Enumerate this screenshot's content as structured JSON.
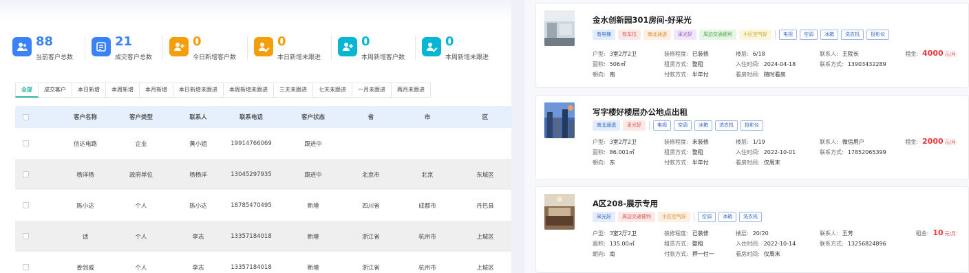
{
  "stats": [
    {
      "value": "88",
      "label": "当前客户总数",
      "color": "#3b82f6",
      "icon": "users-icon"
    },
    {
      "value": "21",
      "label": "成交客户总数",
      "color": "#3b82f6",
      "icon": "deal-icon"
    },
    {
      "value": "0",
      "label": "今日新增客户数",
      "color": "#f59e0b",
      "icon": "user-add-icon"
    },
    {
      "value": "0",
      "label": "本日新增未跟进",
      "color": "#f59e0b",
      "icon": "user-edit-icon"
    },
    {
      "value": "0",
      "label": "本周新增客户数",
      "color": "#06b6d4",
      "icon": "user-add-icon"
    },
    {
      "value": "0",
      "label": "本周新增未跟进",
      "color": "#06b6d4",
      "icon": "user-edit-icon"
    }
  ],
  "tabs": [
    "全部",
    "成交客户",
    "本日新增",
    "本周新增",
    "本月新增",
    "本日新增未跟进",
    "本周新增未跟进",
    "三天未跟进",
    "七天未跟进",
    "一月未跟进",
    "两月未跟进"
  ],
  "table": {
    "headers": [
      "客户名称",
      "客户类型",
      "联系人",
      "联系电话",
      "客户状态",
      "省",
      "市",
      "区"
    ],
    "rows": [
      [
        "信达电路",
        "企业",
        "黄小姐",
        "19914766069",
        "跟进中",
        "",
        "",
        ""
      ],
      [
        "杨洋杨",
        "政府单位",
        "杨杨洋",
        "13045297935",
        "跟进中",
        "北京市",
        "北京",
        "东城区"
      ],
      [
        "陈小达",
        "个人",
        "陈小达",
        "18785470495",
        "新增",
        "四川省",
        "成都市",
        "丹巴县"
      ],
      [
        "话",
        "个人",
        "李志",
        "13357184018",
        "新增",
        "浙江省",
        "杭州市",
        "上城区"
      ],
      [
        "姜剑威",
        "个人",
        "李志",
        "13357184018",
        "新增",
        "浙江省",
        "杭州市",
        "上城区"
      ]
    ]
  },
  "listings": [
    {
      "title": "金水创新园301房间-好采光",
      "tags": [
        {
          "text": "有电梯",
          "style": "blue"
        },
        {
          "text": "有车位",
          "style": "red"
        },
        {
          "text": "南北通透",
          "style": "orange"
        },
        {
          "text": "采光好",
          "style": "purple"
        },
        {
          "text": "周边交通便利",
          "style": "green"
        },
        {
          "text": "小区空气好",
          "style": "yellow"
        }
      ],
      "facilities": [
        "电视",
        "空调",
        "冰箱",
        "洗衣机",
        "投影仪"
      ],
      "huxing_label": "户型:",
      "huxing": "3室2厅2卫",
      "zhuangxiu_label": "装修程度:",
      "zhuangxiu": "已装修",
      "louceng_label": "楼层:",
      "louceng": "6/18",
      "lianxiren_label": "联系人:",
      "lianxiren": "王院长",
      "mianji_label": "面积:",
      "mianji": "506㎡",
      "zulin_label": "租赁方式:",
      "zulin": "整租",
      "ruzhu_label": "入住时间:",
      "ruzhu": "2024-04-18",
      "lianxi_label": "联系方式:",
      "lianxi": "13903432289",
      "chaoxiang_label": "朝向:",
      "chaoxiang": "南",
      "fukuan_label": "付款方式:",
      "fukuan": "半年付",
      "kanfang_label": "看房时间:",
      "kanfang": "随时看房",
      "rent_label": "租金:",
      "rent": "4000",
      "rent_unit": "元/月"
    },
    {
      "title": "写字楼好楼层办公地点出租",
      "tags": [
        {
          "text": "南北通透",
          "style": "blue"
        },
        {
          "text": "采光好",
          "style": "red"
        }
      ],
      "facilities": [
        "电视",
        "空调",
        "冰箱",
        "洗衣机",
        "投影仪"
      ],
      "huxing_label": "户型:",
      "huxing": "3室2厅2卫",
      "zhuangxiu_label": "装修程度:",
      "zhuangxiu": "未装修",
      "louceng_label": "楼层:",
      "louceng": "1/19",
      "lianxiren_label": "联系人:",
      "lianxiren": "微信用户",
      "mianji_label": "面积:",
      "mianji": "86.001㎡",
      "zulin_label": "租赁方式:",
      "zulin": "整租",
      "ruzhu_label": "入住时间:",
      "ruzhu": "2022-10-01",
      "lianxi_label": "联系方式:",
      "lianxi": "17852065399",
      "chaoxiang_label": "朝向:",
      "chaoxiang": "东",
      "fukuan_label": "付款方式:",
      "fukuan": "半年付",
      "kanfang_label": "看房时间:",
      "kanfang": "仅周末",
      "rent_label": "租金:",
      "rent": "2000",
      "rent_unit": "元/月"
    },
    {
      "title": "A区208-展示专用",
      "tags": [
        {
          "text": "采光好",
          "style": "blue"
        },
        {
          "text": "周边交通便利",
          "style": "red"
        },
        {
          "text": "小区空气好",
          "style": "orange"
        }
      ],
      "facilities": [
        "空调",
        "冰箱",
        "洗衣机"
      ],
      "huxing_label": "户型:",
      "huxing": "3室2厅2卫",
      "zhuangxiu_label": "装修程度:",
      "zhuangxiu": "已装修",
      "louceng_label": "楼层:",
      "louceng": "20/20",
      "lianxiren_label": "联系人:",
      "lianxiren": "王芳",
      "mianji_label": "面积:",
      "mianji": "135.00㎡",
      "zulin_label": "租赁方式:",
      "zulin": "整租",
      "ruzhu_label": "入住时间:",
      "ruzhu": "2022-10-14",
      "lianxi_label": "联系方式:",
      "lianxi": "13256824896",
      "chaoxiang_label": "朝向:",
      "chaoxiang": "南",
      "fukuan_label": "付款方式:",
      "fukuan": "押一付一",
      "kanfang_label": "看房时间:",
      "kanfang": "仅周末",
      "rent_label": "租金:",
      "rent": "10",
      "rent_unit": "元/月"
    }
  ]
}
